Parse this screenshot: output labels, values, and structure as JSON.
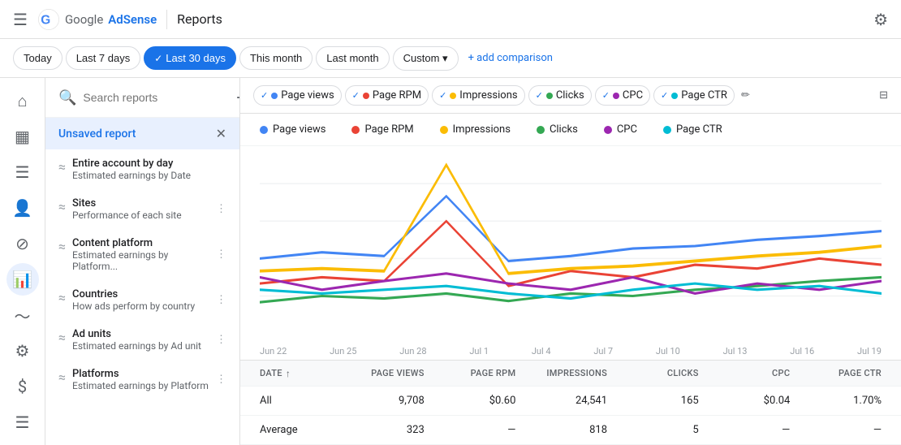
{
  "topbar": {
    "title": "Reports",
    "settings_icon": "⚙"
  },
  "filters": {
    "buttons": [
      {
        "label": "Today",
        "active": false
      },
      {
        "label": "Last 7 days",
        "active": false
      },
      {
        "label": "Last 30 days",
        "active": true,
        "check": "✓"
      },
      {
        "label": "This month",
        "active": false
      },
      {
        "label": "Last month",
        "active": false
      },
      {
        "label": "Custom ▾",
        "active": false
      }
    ],
    "add_comparison": "+ add comparison"
  },
  "sidebar": {
    "search_placeholder": "Search reports",
    "unsaved_label": "Unsaved report",
    "reports": [
      {
        "name": "Entire account by day",
        "desc": "Estimated earnings by Date"
      },
      {
        "name": "Sites",
        "desc": "Performance of each site"
      },
      {
        "name": "Content platform",
        "desc": "Estimated earnings by Platform..."
      },
      {
        "name": "Countries",
        "desc": "How ads perform by country"
      },
      {
        "name": "Ad units",
        "desc": "Estimated earnings by Ad unit"
      },
      {
        "name": "Platforms",
        "desc": "Estimated earnings by Platform"
      }
    ]
  },
  "metrics": {
    "chips": [
      {
        "label": "Page views",
        "color": "#4285f4",
        "active": true
      },
      {
        "label": "Page RPM",
        "color": "#ea4335",
        "active": true
      },
      {
        "label": "Impressions",
        "color": "#fbbc04",
        "active": true
      },
      {
        "label": "Clicks",
        "color": "#34a853",
        "active": true
      },
      {
        "label": "CPC",
        "color": "#9c27b0",
        "active": true
      },
      {
        "label": "Page CTR",
        "color": "#00bcd4",
        "active": true
      }
    ]
  },
  "legend": [
    {
      "label": "Page views",
      "color": "#4285f4"
    },
    {
      "label": "Page RPM",
      "color": "#ea4335"
    },
    {
      "label": "Impressions",
      "color": "#fbbc04"
    },
    {
      "label": "Clicks",
      "color": "#34a853"
    },
    {
      "label": "CPC",
      "color": "#9c27b0"
    },
    {
      "label": "Page CTR",
      "color": "#00bcd4"
    }
  ],
  "xaxis": [
    "Jun 22",
    "Jun 25",
    "Jun 28",
    "Jul 1",
    "Jul 4",
    "Jul 7",
    "Jul 10",
    "Jul 13",
    "Jul 16",
    "Jul 19"
  ],
  "table": {
    "headers": [
      "DATE",
      "Page views",
      "Page RPM",
      "Impressions",
      "Clicks",
      "CPC",
      "Page CTR"
    ],
    "rows": [
      {
        "label": "All",
        "values": [
          "9,708",
          "$0.60",
          "24,541",
          "165",
          "$0.04",
          "1.70%"
        ]
      },
      {
        "label": "Average",
        "values": [
          "323",
          "—",
          "818",
          "5",
          "—",
          "—"
        ]
      }
    ]
  }
}
